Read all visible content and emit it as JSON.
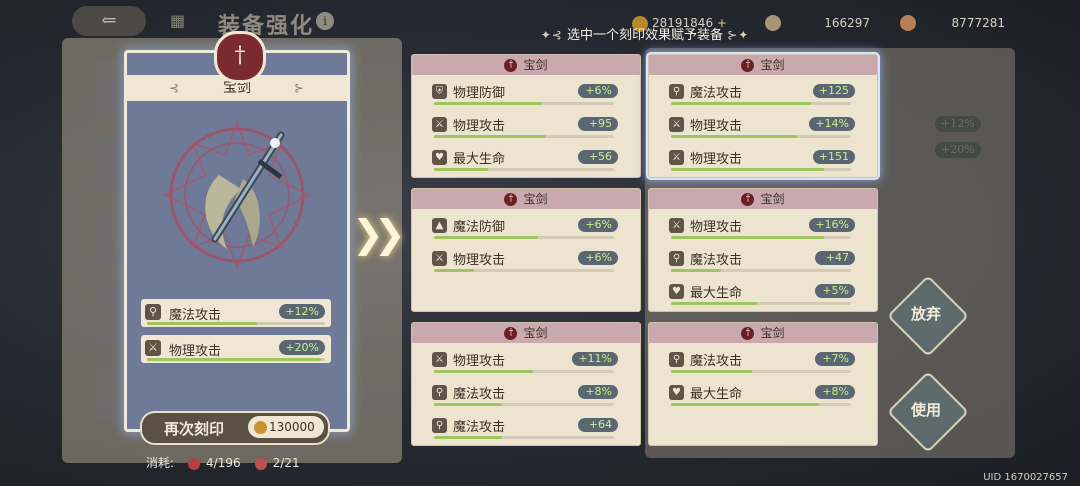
{
  "background": {
    "title": "装备强化",
    "back_icon": "back-arrow-icon",
    "currencies": [
      {
        "icon": "gold-coin-icon",
        "value": "28191846",
        "color": "#c6922c"
      },
      {
        "icon": "horn-icon",
        "value": "166297",
        "color": "#b9a37a"
      },
      {
        "icon": "pouch-icon",
        "value": "8777281",
        "color": "#c9885a"
      }
    ],
    "stats": [
      "+12%",
      "+20%"
    ]
  },
  "header": {
    "text": "选中一个刻印效果赋予装备"
  },
  "card": {
    "name": "宝剑",
    "medal_icon": "sword-icon",
    "stats": [
      {
        "icon": "magic-wand-icon",
        "label": "魔法攻击",
        "value": "+12%",
        "fill": 0.62
      },
      {
        "icon": "sword-icon",
        "label": "物理攻击",
        "value": "+20%",
        "fill": 0.98
      }
    ],
    "reprint_label": "再次刻印",
    "reprint_cost": "130000",
    "consume_label": "消耗:",
    "consume": [
      {
        "icon": "gem-icon",
        "value": "4/196"
      },
      {
        "icon": "gem-icon",
        "value": "2/21"
      }
    ]
  },
  "options": [
    {
      "title": "宝剑",
      "selected": false,
      "rows": [
        {
          "icon": "shield-icon",
          "label": "物理防御",
          "value": "+6%",
          "fill": 0.6
        },
        {
          "icon": "sword-icon",
          "label": "物理攻击",
          "value": "+95",
          "fill": 0.62
        },
        {
          "icon": "heart-icon",
          "label": "最大生命",
          "value": "+56",
          "fill": 0.3
        }
      ]
    },
    {
      "title": "宝剑",
      "selected": true,
      "rows": [
        {
          "icon": "magic-wand-icon",
          "label": "魔法攻击",
          "value": "+125",
          "fill": 0.78
        },
        {
          "icon": "sword-icon",
          "label": "物理攻击",
          "value": "+14%",
          "fill": 0.7
        },
        {
          "icon": "sword-icon",
          "label": "物理攻击",
          "value": "+151",
          "fill": 0.85
        }
      ]
    },
    {
      "title": "宝剑",
      "selected": false,
      "rows": [
        {
          "icon": "wizard-hat-icon",
          "label": "魔法防御",
          "value": "+6%",
          "fill": 0.58
        },
        {
          "icon": "sword-icon",
          "label": "物理攻击",
          "value": "+6%",
          "fill": 0.22
        }
      ]
    },
    {
      "title": "宝剑",
      "selected": false,
      "rows": [
        {
          "icon": "sword-icon",
          "label": "物理攻击",
          "value": "+16%",
          "fill": 0.85
        },
        {
          "icon": "magic-wand-icon",
          "label": "魔法攻击",
          "value": "+47",
          "fill": 0.28
        },
        {
          "icon": "heart-icon",
          "label": "最大生命",
          "value": "+5%",
          "fill": 0.48
        }
      ]
    },
    {
      "title": "宝剑",
      "selected": false,
      "rows": [
        {
          "icon": "sword-icon",
          "label": "物理攻击",
          "value": "+11%",
          "fill": 0.55
        },
        {
          "icon": "magic-wand-icon",
          "label": "魔法攻击",
          "value": "+8%",
          "fill": 0.38
        },
        {
          "icon": "magic-wand-icon",
          "label": "魔法攻击",
          "value": "+64",
          "fill": 0.38
        }
      ]
    },
    {
      "title": "宝剑",
      "selected": false,
      "rows": [
        {
          "icon": "magic-wand-icon",
          "label": "魔法攻击",
          "value": "+7%",
          "fill": 0.45
        },
        {
          "icon": "heart-icon",
          "label": "最大生命",
          "value": "+8%",
          "fill": 0.82
        }
      ]
    }
  ],
  "buttons": {
    "abandon": "放弃",
    "use": "使用"
  },
  "uid": "UID 1670027657"
}
